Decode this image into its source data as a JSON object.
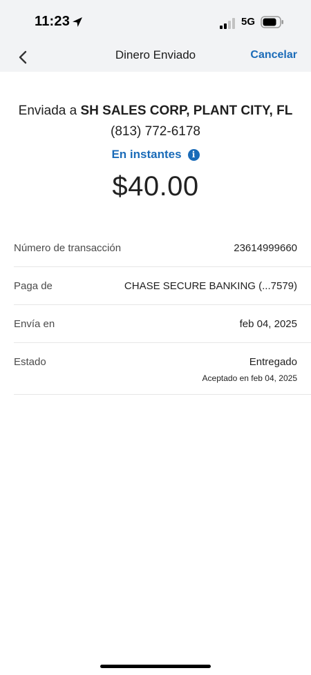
{
  "status_bar": {
    "time": "11:23",
    "network": "5G"
  },
  "nav": {
    "title": "Dinero Enviado",
    "cancel_label": "Cancelar"
  },
  "summary": {
    "recipient_prefix": "Enviada a ",
    "recipient_name": "SH SALES CORP, PLANT CITY, FL",
    "recipient_phone": "(813) 772-6178",
    "speed_label": "En instantes",
    "info_glyph": "i",
    "amount": "$40.00"
  },
  "details": {
    "rows": [
      {
        "label": "Número de transacción",
        "value": "23614999660"
      },
      {
        "label": "Paga de",
        "value": "CHASE SECURE BANKING (...7579)"
      },
      {
        "label": "Envía en",
        "value": "feb 04, 2025"
      },
      {
        "label": "Estado",
        "value": "Entregado",
        "subvalue": "Aceptado en feb 04, 2025"
      }
    ]
  },
  "colors": {
    "accent": "#1a6bb8",
    "header_bg": "#f2f3f5"
  }
}
